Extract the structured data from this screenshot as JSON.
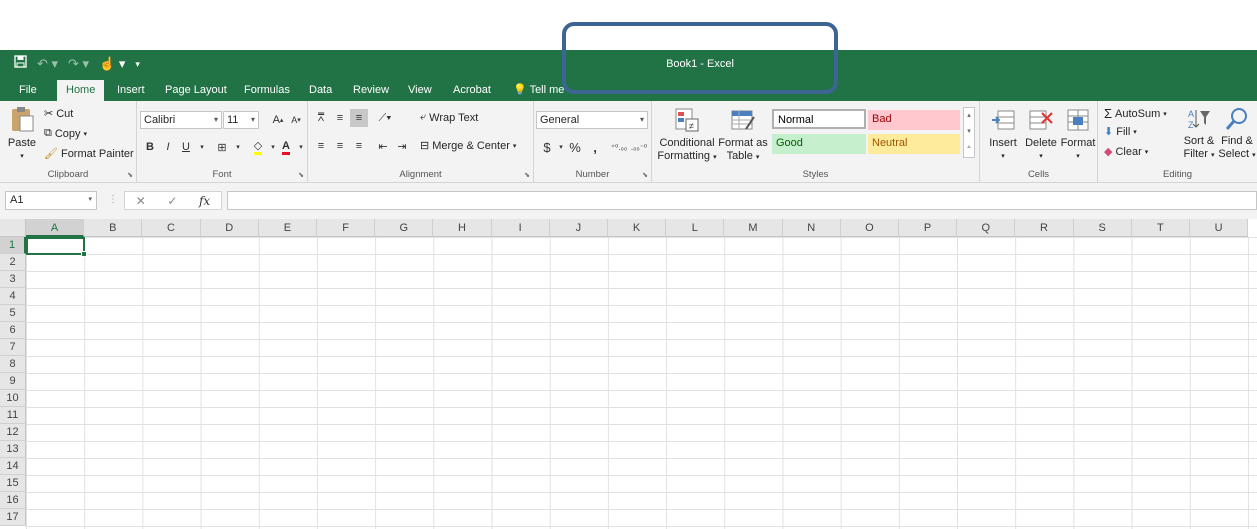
{
  "window": {
    "title": "Book1 - Excel"
  },
  "qat": {
    "save_icon": "save-icon",
    "undo_icon": "undo-icon",
    "redo_icon": "redo-icon",
    "touch_icon": "touch-mode-icon"
  },
  "tabs": [
    {
      "label": "File"
    },
    {
      "label": "Home"
    },
    {
      "label": "Insert"
    },
    {
      "label": "Page Layout"
    },
    {
      "label": "Formulas"
    },
    {
      "label": "Data"
    },
    {
      "label": "Review"
    },
    {
      "label": "View"
    },
    {
      "label": "Acrobat"
    },
    {
      "label": "Tell me"
    }
  ],
  "clipboard": {
    "paste": "Paste",
    "cut": "Cut",
    "copy": "Copy",
    "format_painter": "Format Painter",
    "label": "Clipboard"
  },
  "font": {
    "name": "Calibri",
    "size": "11",
    "bold": "B",
    "italic": "I",
    "underline": "U",
    "grow": "A",
    "shrink": "A",
    "font_color": "A",
    "label": "Font",
    "font_color_hex": "#e81123",
    "highlight_hex": "#ffff00"
  },
  "alignment": {
    "wrap_text": "Wrap Text",
    "merge_center": "Merge & Center",
    "label": "Alignment"
  },
  "number": {
    "format": "General",
    "currency": "$",
    "percent": "%",
    "comma": ",",
    "label": "Number"
  },
  "styles": {
    "conditional": "Conditional",
    "conditional2": "Formatting",
    "format_as": "Format as",
    "format_as2": "Table",
    "normal": "Normal",
    "bad": "Bad",
    "good": "Good",
    "neutral": "Neutral",
    "label": "Styles"
  },
  "cells": {
    "insert": "Insert",
    "delete": "Delete",
    "format": "Format",
    "label": "Cells"
  },
  "editing": {
    "autosum": "AutoSum",
    "fill": "Fill",
    "clear": "Clear",
    "sort": "Sort &",
    "sort2": "Filter",
    "find": "Find &",
    "find2": "Select",
    "label": "Editing"
  },
  "formula_bar": {
    "name_box": "A1",
    "fx": "fx",
    "value": ""
  },
  "columns": [
    "A",
    "B",
    "C",
    "D",
    "E",
    "F",
    "G",
    "H",
    "I",
    "J",
    "K",
    "L",
    "M",
    "N",
    "O",
    "P",
    "Q",
    "R",
    "S",
    "T",
    "U"
  ],
  "rows": [
    "1",
    "2",
    "3",
    "4",
    "5",
    "6",
    "7",
    "8",
    "9",
    "10",
    "11",
    "12",
    "13",
    "14",
    "15",
    "16",
    "17"
  ],
  "colors": {
    "accent": "#217346"
  }
}
